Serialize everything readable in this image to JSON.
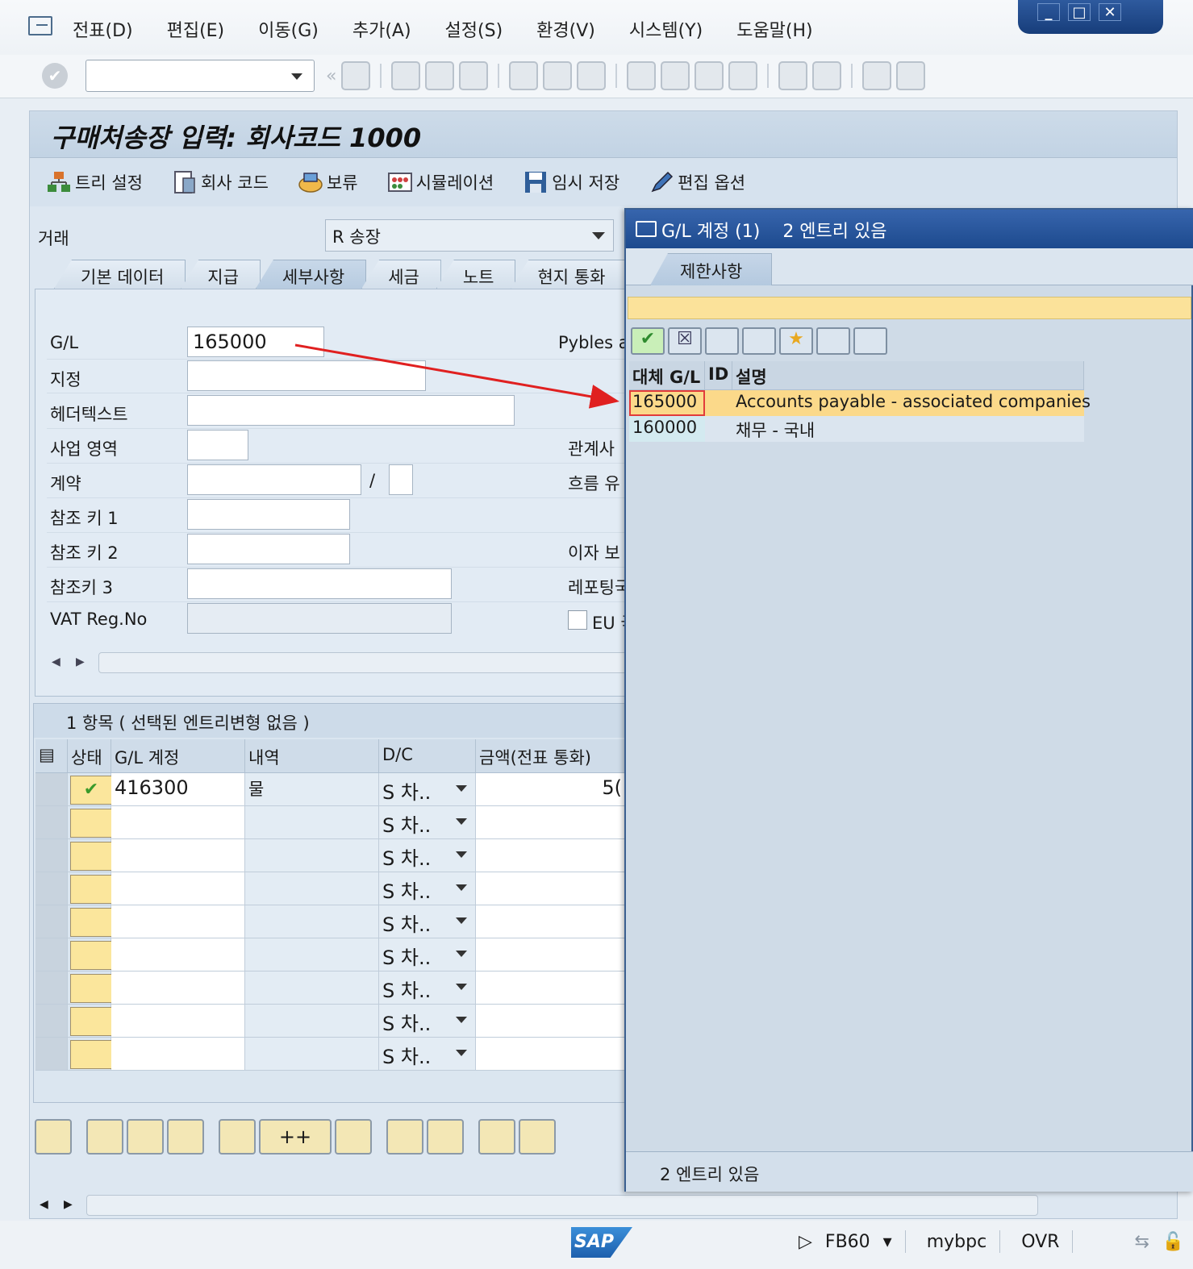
{
  "menu": [
    "전표(D)",
    "편집(E)",
    "이동(G)",
    "추가(A)",
    "설정(S)",
    "환경(V)",
    "시스템(Y)",
    "도움말(H)"
  ],
  "toolbar": {
    "nav_back_glyph": "«"
  },
  "screen_title": "구매처송장 입력: 회사코드 1000",
  "app_buttons": [
    "트리 설정",
    "회사 코드",
    "보류",
    "시뮬레이션",
    "임시 저장",
    "편집 옵션"
  ],
  "transaction": {
    "label": "거래",
    "value": "R 송장"
  },
  "tabs": [
    "기본 데이터",
    "지급",
    "세부사항",
    "세금",
    "노트",
    "현지 통화"
  ],
  "fields": {
    "gl_label": "G/L",
    "gl_value": "165000",
    "assign_label": "지정",
    "header_text_label": "헤더텍스트",
    "business_area_label": "사업 영역",
    "contract_label": "계약",
    "contract_sep": "/",
    "ref1_label": "참조 키 1",
    "ref2_label": "참조 키 2",
    "ref3_label": "참조키 3",
    "vat_label": "VAT Reg.No"
  },
  "right_labels": {
    "pybles": "Pybles a",
    "affiliate": "관계사",
    "flow": "흐름 유",
    "interest": "이자 보",
    "refer": "레포팅국",
    "eu": "EU 국"
  },
  "items": {
    "summary": "1 항목 ( 선택된 엔트리변형 없음 )",
    "columns": [
      "상태",
      "G/L 계정",
      "내역",
      "D/C",
      "금액(전표 통화)"
    ],
    "rows": [
      {
        "gl": "416300",
        "text": "물",
        "dc": "S 차..",
        "amount": "5("
      },
      {
        "gl": "",
        "text": "",
        "dc": "S 차..",
        "amount": ""
      },
      {
        "gl": "",
        "text": "",
        "dc": "S 차..",
        "amount": ""
      },
      {
        "gl": "",
        "text": "",
        "dc": "S 차..",
        "amount": ""
      },
      {
        "gl": "",
        "text": "",
        "dc": "S 차..",
        "amount": ""
      },
      {
        "gl": "",
        "text": "",
        "dc": "S 차..",
        "amount": ""
      },
      {
        "gl": "",
        "text": "",
        "dc": "S 차..",
        "amount": ""
      },
      {
        "gl": "",
        "text": "",
        "dc": "S 차..",
        "amount": ""
      },
      {
        "gl": "",
        "text": "",
        "dc": "S 차..",
        "amount": ""
      }
    ],
    "add_label": "++"
  },
  "popup": {
    "title": "G/L 계정 (1)    2 엔트리 있음",
    "tab": "제한사항",
    "columns": [
      "대체 G/L",
      "ID",
      "설명"
    ],
    "rows": [
      {
        "gl": "165000",
        "id": "",
        "desc": "Accounts payable - associated companies"
      },
      {
        "gl": "160000",
        "id": "",
        "desc": "채무 - 국내"
      }
    ],
    "footer": "2 엔트리 있음"
  },
  "status": {
    "logo": "SAP",
    "tcode": "FB60",
    "server": "mybpc",
    "mode": "OVR"
  },
  "colors": {
    "highlight": "#fbd98a",
    "arrow": "#e02020",
    "title_blue": "#1d4a8e"
  }
}
